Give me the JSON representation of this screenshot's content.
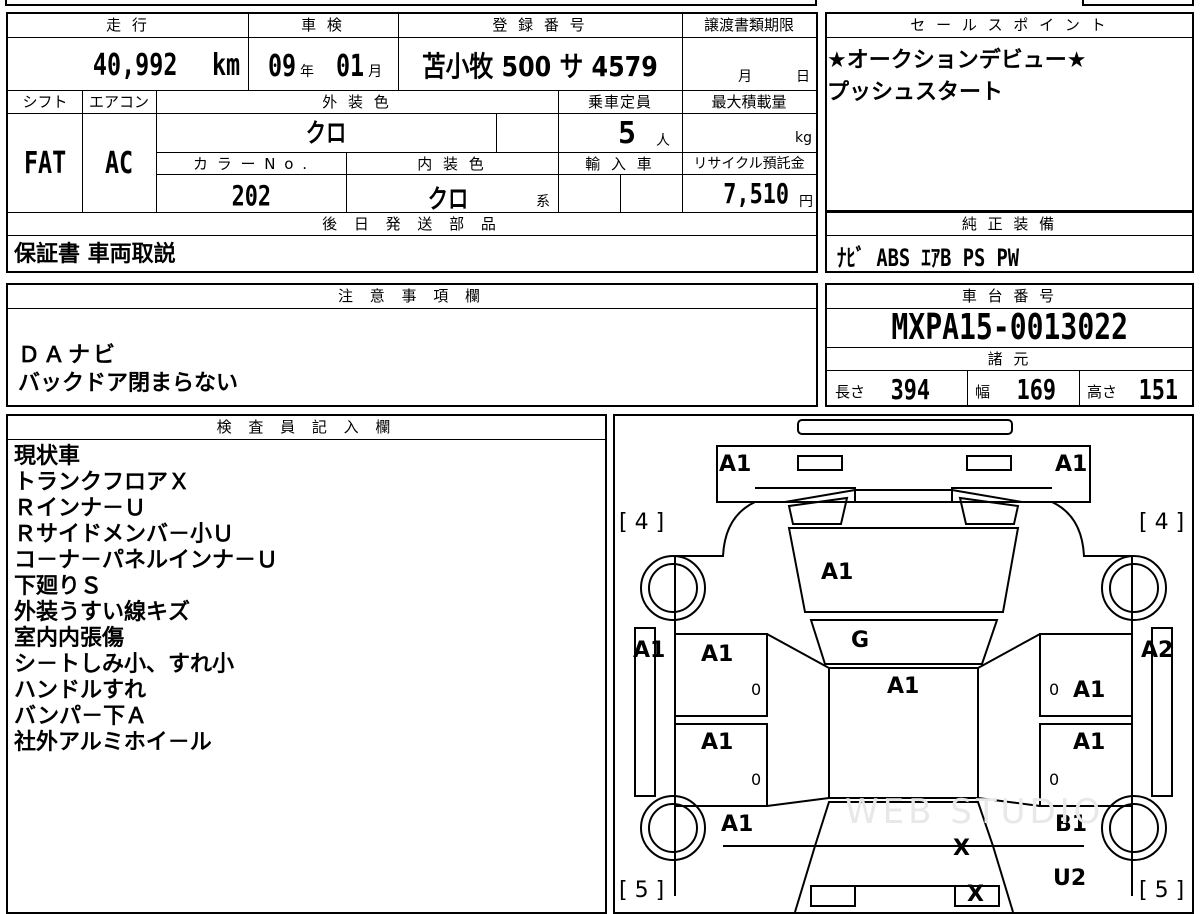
{
  "top_table": {
    "headers": {
      "mileage": "走 行",
      "inspection": "車 検",
      "registration": "登 録 番 号",
      "transfer_deadline": "譲渡書類期限",
      "shift": "シフト",
      "aircon": "エアコン",
      "exterior_color": "外 装 色",
      "capacity": "乗車定員",
      "max_load": "最大積載量",
      "color_no": "カ ラ ー N o .",
      "interior_color": "内 装 色",
      "import": "輸 入 車",
      "recycle": "リサイクル預託金",
      "later_parts": "後 日 発 送 部 品"
    },
    "mileage_value": "40,992",
    "mileage_unit": "km",
    "inspection_year": "09",
    "year_unit": "年",
    "inspection_month": "01",
    "month_unit": "月",
    "registration_number": "苫小牧 500 サ 4579",
    "deadline_month_unit": "月",
    "deadline_day_unit": "日",
    "shift_value": "FAT",
    "aircon_value": "AC",
    "exterior_color_value": "クロ",
    "capacity_value": "5",
    "capacity_unit": "人",
    "max_load_unit": "kg",
    "color_no_value": "202",
    "interior_color_value": "クロ",
    "interior_suffix": "系",
    "recycle_value": "7,510",
    "recycle_unit": "円",
    "later_parts_value": "保証書 車両取説"
  },
  "sales_points": {
    "header": "セ ー ル ス ポ イ ン ト",
    "lines": [
      "★オークションデビュー★",
      "プッシュスタート"
    ]
  },
  "genuine_equipment": {
    "header": "純 正 装 備",
    "value": "ﾅﾋﾞ ABS ｴｱB PS PW"
  },
  "notes": {
    "header": "注 意 事 項 欄",
    "lines": [
      "ＤＡナビ",
      "バックドア閉まらない"
    ]
  },
  "chassis": {
    "header": "車 台 番 号",
    "value": "MXPA15-0013022",
    "spec_header": "諸 元",
    "length_label": "長さ",
    "length_value": "394",
    "width_label": "幅",
    "width_value": "169",
    "height_label": "高さ",
    "height_value": "151"
  },
  "inspector": {
    "header": "検 査 員 記 入 欄",
    "lines": [
      "現状車",
      "トランクフロアＸ",
      "Ｒインナ－Ｕ",
      "Ｒサイドメンバ－小Ｕ",
      "コ－ナ－パネルインナ－Ｕ",
      "下廻りＳ",
      "外装うすい線キズ",
      "室内内張傷",
      "シ－トしみ小、すれ小",
      "ハンドルすれ",
      "バンパ－下Ａ",
      "社外アルミホイ－ル"
    ]
  },
  "diagram": {
    "labels": {
      "front_left": "A1",
      "front_right": "A1",
      "bracket_front_left": "[ 4 ]",
      "bracket_front_right": "[ 4 ]",
      "bracket_rear_left": "[ 5 ]",
      "bracket_rear_right": "[ 5 ]",
      "hood": "A1",
      "windshield": "G",
      "roof": "A1",
      "left_fender": "A1",
      "right_fender": "A2",
      "left_front_door": "A1",
      "right_front_door": "A1",
      "left_rear_door": "A1",
      "right_rear_door": "A1",
      "left_quarter": "A1",
      "right_quarter": "B1",
      "rear_center": "X",
      "right_rear": "U2",
      "rear_bottom": "X",
      "door_mark": "0",
      "watermark": "WEB STUDIO"
    }
  }
}
